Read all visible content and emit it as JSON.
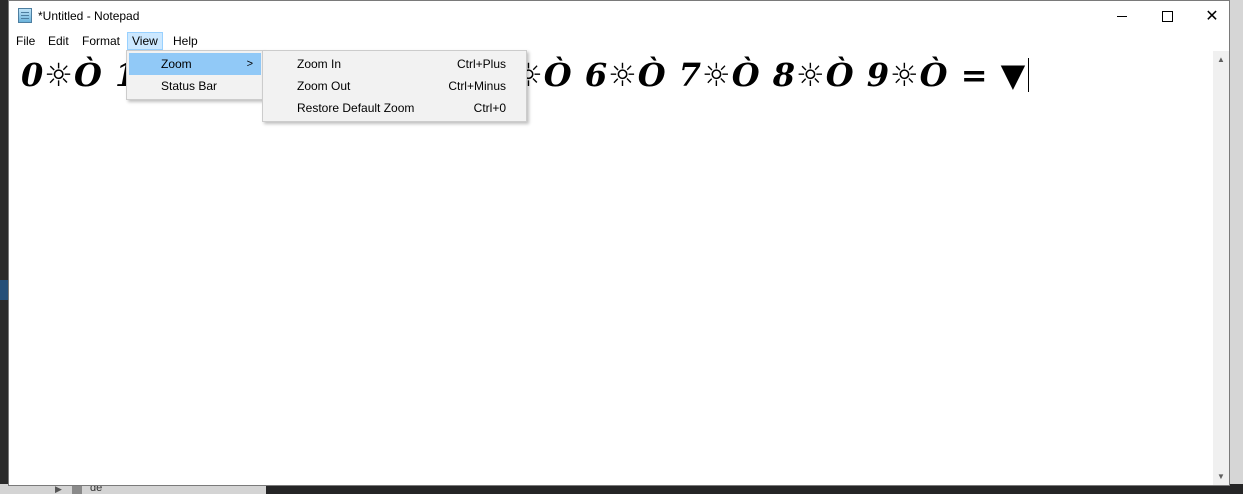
{
  "window": {
    "title": "*Untitled - Notepad",
    "minimize_glyph": "",
    "maximize_glyph": "",
    "close_glyph": "✕"
  },
  "menubar": {
    "file": "File",
    "edit": "Edit",
    "format": "Format",
    "view": "View",
    "help": "Help"
  },
  "editor": {
    "content": "0☼Ò 1☼Ò 2☼Ò 3☼Ò 4☼Ò 5☼Ò 6☼Ò 7☼Ò 8☼Ò 9☼Ò = ▼"
  },
  "view_menu": {
    "items": [
      {
        "label": "Zoom",
        "has_submenu": true,
        "highlighted": true
      },
      {
        "label": "Status Bar",
        "has_submenu": false,
        "highlighted": false
      }
    ]
  },
  "zoom_menu": {
    "items": [
      {
        "label": "Zoom In",
        "shortcut": "Ctrl+Plus"
      },
      {
        "label": "Zoom Out",
        "shortcut": "Ctrl+Minus"
      },
      {
        "label": "Restore Default Zoom",
        "shortcut": "Ctrl+0"
      }
    ]
  },
  "background": {
    "tree_item": "de"
  },
  "colors": {
    "menu_highlight": "#91c9f7",
    "menubar_active": "#cce8ff",
    "menu_bg": "#f2f2f2"
  }
}
